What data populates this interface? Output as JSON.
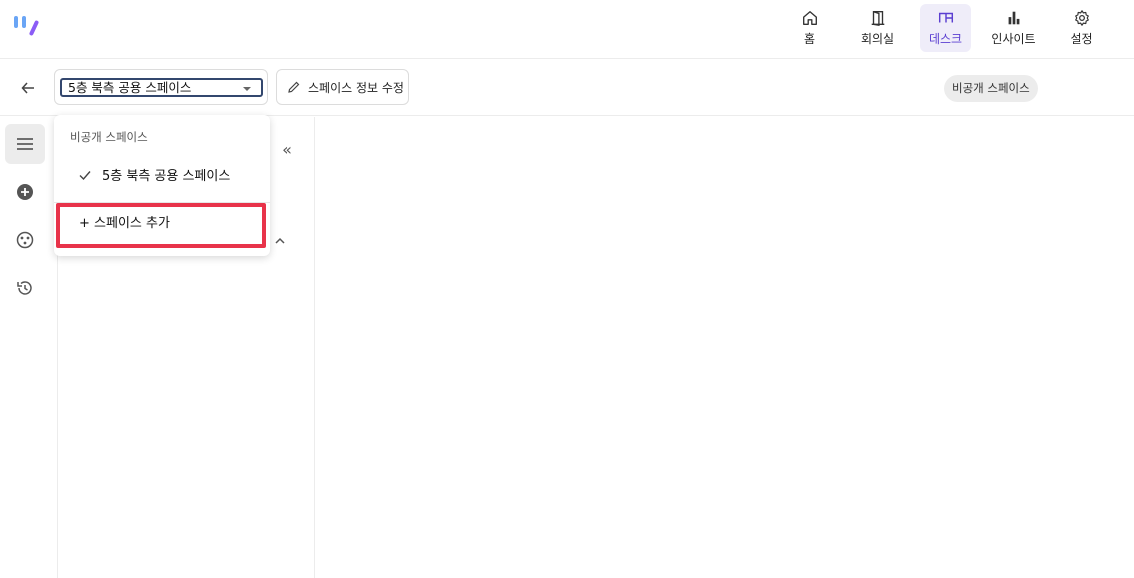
{
  "nav": {
    "items": [
      {
        "label": "홈",
        "icon": "home-icon"
      },
      {
        "label": "회의실",
        "icon": "door-icon"
      },
      {
        "label": "데스크",
        "icon": "desk-icon",
        "active": true
      },
      {
        "label": "인사이트",
        "icon": "bar-chart-icon"
      },
      {
        "label": "설정",
        "icon": "gear-icon"
      }
    ]
  },
  "toolbar": {
    "space_select_value": "5층 북측 공용 스페이스",
    "edit_button_label": "스페이스 정보 수정",
    "visibility_badge": "비공개 스페이스"
  },
  "dropdown": {
    "group_header": "비공개 스페이스",
    "options": [
      {
        "label": "5층 북측 공용 스페이스",
        "selected": true
      }
    ],
    "add_label": "+ 스페이스 추가"
  },
  "sidebar": {
    "collapse_label": "«"
  },
  "colors": {
    "accent": "#5b3fd1",
    "active_nav_bg": "#efedf9",
    "highlight": "#e8334a",
    "logo_blue": "#6aa5f5",
    "logo_purple": "#8b5cf6"
  }
}
